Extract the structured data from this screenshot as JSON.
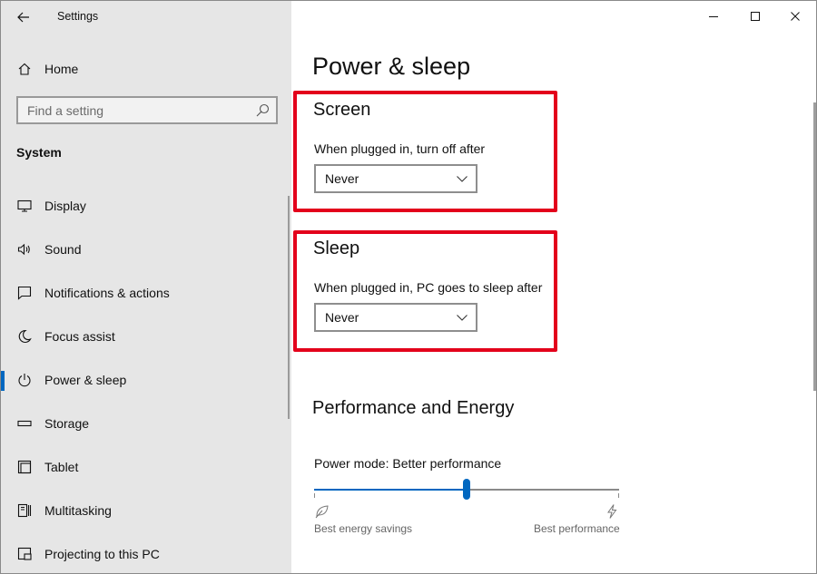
{
  "window": {
    "title": "Settings"
  },
  "sidebar": {
    "home_label": "Home",
    "search_placeholder": "Find a setting",
    "section_label": "System",
    "items": [
      {
        "label": "Display",
        "icon": "monitor-icon",
        "selected": false
      },
      {
        "label": "Sound",
        "icon": "speaker-icon",
        "selected": false
      },
      {
        "label": "Notifications & actions",
        "icon": "notification-icon",
        "selected": false
      },
      {
        "label": "Focus assist",
        "icon": "moon-icon",
        "selected": false
      },
      {
        "label": "Power & sleep",
        "icon": "power-icon",
        "selected": true
      },
      {
        "label": "Storage",
        "icon": "storage-icon",
        "selected": false
      },
      {
        "label": "Tablet",
        "icon": "tablet-icon",
        "selected": false
      },
      {
        "label": "Multitasking",
        "icon": "multitasking-icon",
        "selected": false
      },
      {
        "label": "Projecting to this PC",
        "icon": "projecting-icon",
        "selected": false
      }
    ]
  },
  "main": {
    "title": "Power & sleep",
    "screen": {
      "heading": "Screen",
      "label": "When plugged in, turn off after",
      "value": "Never"
    },
    "sleep": {
      "heading": "Sleep",
      "label": "When plugged in, PC goes to sleep after",
      "value": "Never"
    },
    "performance": {
      "heading": "Performance and Energy",
      "mode_label": "Power mode: Better performance",
      "slider_fraction": 0.5,
      "min_label": "Best energy savings",
      "max_label": "Best performance"
    }
  },
  "colors": {
    "accent": "#0067c0",
    "highlight": "#e3001b",
    "sidebar_bg": "#e6e6e6"
  }
}
